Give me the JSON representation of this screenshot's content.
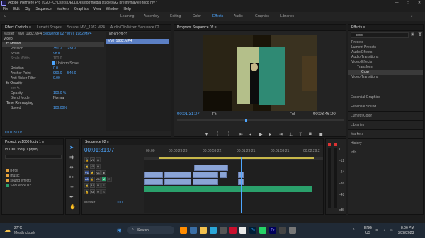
{
  "titlebar": {
    "title": "Adobe Premiere Pro 2020 - C:\\Users\\DELL\\Desktop\\media studies\\A2 prelim\\maylee todd mv *",
    "minimize": "—",
    "maximize": "□",
    "close": "✕"
  },
  "menu": [
    "File",
    "Edit",
    "Clip",
    "Sequence",
    "Markers",
    "Graphics",
    "View",
    "Window",
    "Help"
  ],
  "workspaces": [
    "Learning",
    "Assembly",
    "Editing",
    "Color",
    "Effects",
    "Audio",
    "Graphics",
    "Libraries"
  ],
  "effect_controls": {
    "tabs": [
      "Effect Controls ≡",
      "Lumetri Scopes",
      "Source: MVI_1982.MP4",
      "Audio Clip Mixer: Sequence 02"
    ],
    "master_label": "Master * MVI_1982.MP4",
    "seq_label": "Sequence 02 * MVI_1982.MP4",
    "clip_timecode": "00:01:29:21",
    "clip_name": "MVI_1982.MP4",
    "video_label": "Video",
    "motion": "Motion",
    "position": {
      "label": "Position",
      "x": "351.2",
      "y": "238.2"
    },
    "scale": {
      "label": "Scale",
      "value": "98.0"
    },
    "scale_width": {
      "label": "Scale Width",
      "value": "100.0"
    },
    "uniform": "Uniform Scale",
    "rotation": {
      "label": "Rotation",
      "value": "0.0"
    },
    "anchor": {
      "label": "Anchor Point",
      "x": "960.0",
      "y": "540.0"
    },
    "antiflicker": {
      "label": "Anti-flicker Filter",
      "value": "0.00"
    },
    "opacity": "Opacity",
    "opacity_val": {
      "label": "Opacity",
      "value": "100.0 %"
    },
    "blend": {
      "label": "Blend Mode",
      "value": "Normal"
    },
    "timeremap": "Time Remapping",
    "speed": {
      "label": "Speed",
      "value": "100.00%"
    },
    "footer_time": "00:01:31:07"
  },
  "monitor": {
    "tab": "Program: Sequence 02 ≡",
    "timecode": "00:01:31:07",
    "fit": "Fit",
    "full": "Full",
    "duration": "00:03:46:00"
  },
  "effects": {
    "tab": "Effects ≡",
    "search": "crop",
    "tree": [
      "Presets",
      "Lumetri Presets",
      "Audio Effects",
      "Audio Transitions",
      "Video Effects",
      "Transform",
      "Crop",
      "Video Transitions"
    ],
    "sections": [
      "Essential Graphics",
      "Essential Sound",
      "Lumetri Color",
      "Libraries",
      "Markers",
      "History",
      "Info"
    ]
  },
  "project": {
    "tab": "Project: vs1000 footy 1 ≡",
    "file": "vs1000 footy 1.prproj",
    "items": [
      "b-roll",
      "music",
      "sound effects",
      "Sequence 02"
    ]
  },
  "timeline": {
    "tab": "Sequence 02 ≡",
    "timecode": "00:01:31:07",
    "ruler": [
      "00:00",
      "00:00:29:23",
      "00:00:59:22",
      "00:01:29:21",
      "00:01:59:21",
      "00:02:29:2"
    ],
    "tracks": [
      "V3",
      "V2",
      "V1",
      "A1",
      "A2",
      "A3"
    ],
    "master": "Master",
    "master_val": "0.0"
  },
  "meter": {
    "labels": [
      "0",
      "-12",
      "-24",
      "-36",
      "-48",
      "dB"
    ]
  },
  "taskbar": {
    "temp": "27°C",
    "weather": "Mostly cloudy",
    "search": "Search",
    "lang": "ENG",
    "region": "US",
    "time": "8:06 PM",
    "date": "3/28/2023"
  },
  "colors": {
    "accent": "#4da6ff",
    "audio": "#2aa06b",
    "video": "#8aa4d6",
    "playhead": "#4da6ff"
  }
}
